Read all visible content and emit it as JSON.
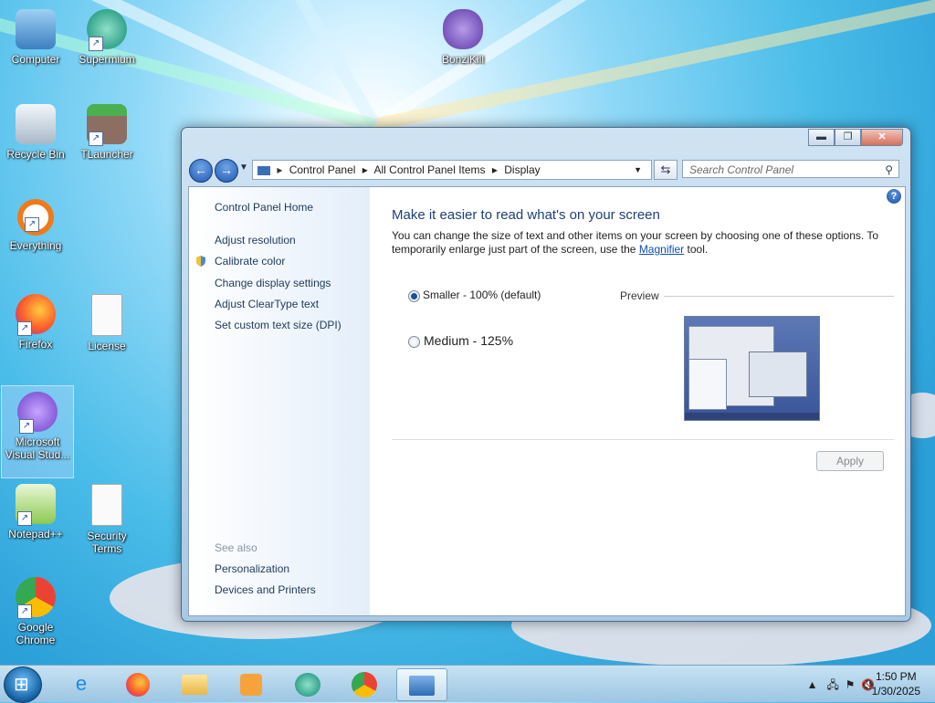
{
  "desktop": {
    "icons": [
      {
        "label": "Computer",
        "icon": "computer-icon"
      },
      {
        "label": "Supermium",
        "icon": "supermium-icon"
      },
      {
        "label": "BonziKill",
        "icon": "bonzikill-icon"
      },
      {
        "label": "Recycle Bin",
        "icon": "recycle-bin-icon"
      },
      {
        "label": "TLauncher",
        "icon": "tlauncher-icon"
      },
      {
        "label": "Everything",
        "icon": "everything-icon"
      },
      {
        "label": "Firefox",
        "icon": "firefox-icon"
      },
      {
        "label": "License",
        "icon": "document-icon"
      },
      {
        "label": "Microsoft Visual Stud...",
        "icon": "visual-studio-icon"
      },
      {
        "label": "Notepad++",
        "icon": "notepadpp-icon"
      },
      {
        "label": "Security Terms",
        "icon": "document-icon"
      },
      {
        "label": "Google Chrome",
        "icon": "chrome-icon"
      }
    ]
  },
  "window": {
    "controls": {
      "minimize": "▬",
      "maximize": "❐",
      "close": "✕"
    },
    "breadcrumb": [
      "Control Panel",
      "All Control Panel Items",
      "Display"
    ],
    "search_placeholder": "Search Control Panel",
    "sidebar": {
      "home": "Control Panel Home",
      "links": [
        "Adjust resolution",
        "Calibrate color",
        "Change display settings",
        "Adjust ClearType text",
        "Set custom text size (DPI)"
      ],
      "see_also_title": "See also",
      "see_also": [
        "Personalization",
        "Devices and Printers"
      ]
    },
    "main": {
      "heading": "Make it easier to read what's on your screen",
      "desc_before": "You can change the size of text and other items on your screen by choosing one of these options. To temporarily enlarge just part of the screen, use the ",
      "desc_link": "Magnifier",
      "desc_after": " tool.",
      "options": [
        {
          "label": "Smaller - 100% (default)",
          "selected": true
        },
        {
          "label": "Medium - 125%",
          "selected": false
        }
      ],
      "preview_label": "Preview",
      "apply_label": "Apply"
    }
  },
  "taskbar": {
    "items": [
      "start-orb",
      "internet-explorer-icon",
      "firefox-icon",
      "file-explorer-icon",
      "media-player-icon",
      "supermium-icon",
      "chrome-icon",
      "control-panel-icon"
    ],
    "time": "1:50 PM",
    "date": "1/30/2025"
  },
  "colors": {
    "accent": "#1e3f7a",
    "link": "#0a4fb0",
    "sky": "#4bbde9"
  }
}
